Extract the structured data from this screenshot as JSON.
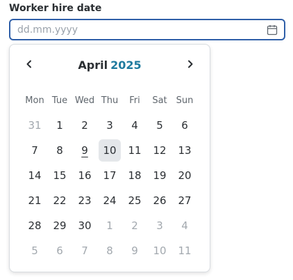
{
  "field": {
    "label": "Worker hire date",
    "value": "",
    "placeholder": "dd.mm.yyyy",
    "icon": "calendar-icon"
  },
  "calendar": {
    "month": "April",
    "year": "2025",
    "prev_icon": "chevron-left-icon",
    "next_icon": "chevron-right-icon",
    "weekdays": [
      "Mon",
      "Tue",
      "Wed",
      "Thu",
      "Fri",
      "Sat",
      "Sun"
    ],
    "weeks": [
      [
        {
          "d": "31",
          "muted": true
        },
        {
          "d": "1"
        },
        {
          "d": "2"
        },
        {
          "d": "3"
        },
        {
          "d": "4"
        },
        {
          "d": "5"
        },
        {
          "d": "6"
        }
      ],
      [
        {
          "d": "7"
        },
        {
          "d": "8"
        },
        {
          "d": "9",
          "today": true
        },
        {
          "d": "10",
          "selected": true
        },
        {
          "d": "11"
        },
        {
          "d": "12"
        },
        {
          "d": "13"
        }
      ],
      [
        {
          "d": "14"
        },
        {
          "d": "15"
        },
        {
          "d": "16"
        },
        {
          "d": "17"
        },
        {
          "d": "18"
        },
        {
          "d": "19"
        },
        {
          "d": "20"
        }
      ],
      [
        {
          "d": "21"
        },
        {
          "d": "22"
        },
        {
          "d": "23"
        },
        {
          "d": "24"
        },
        {
          "d": "25"
        },
        {
          "d": "26"
        },
        {
          "d": "27"
        }
      ],
      [
        {
          "d": "28"
        },
        {
          "d": "29"
        },
        {
          "d": "30"
        },
        {
          "d": "1",
          "muted": true
        },
        {
          "d": "2",
          "muted": true
        },
        {
          "d": "3",
          "muted": true
        },
        {
          "d": "4",
          "muted": true
        }
      ],
      [
        {
          "d": "5",
          "muted": true
        },
        {
          "d": "6",
          "muted": true
        },
        {
          "d": "7",
          "muted": true
        },
        {
          "d": "8",
          "muted": true
        },
        {
          "d": "9",
          "muted": true
        },
        {
          "d": "10",
          "muted": true
        },
        {
          "d": "11",
          "muted": true
        }
      ]
    ]
  },
  "colors": {
    "accent_border": "#2f5fa8",
    "year_text": "#1f7a9e",
    "selected_bg": "#e4e7ea",
    "muted_text": "#a2a8ae"
  }
}
